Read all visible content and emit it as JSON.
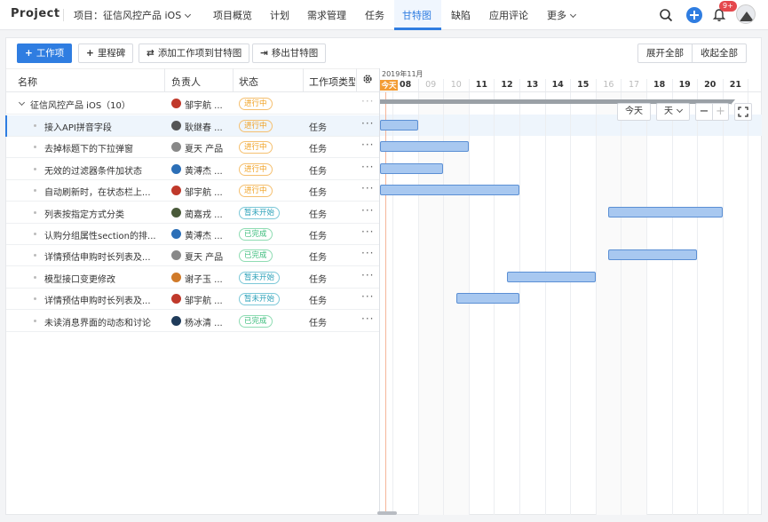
{
  "brand": "Project",
  "project_selector": "项目：征信风控产品 iOS",
  "nav": [
    "项目概览",
    "计划",
    "需求管理",
    "任务",
    "甘特图",
    "缺陷",
    "应用评论",
    "更多"
  ],
  "nav_active": "甘特图",
  "notification_badge": "9+",
  "toolbar": {
    "add_item": "工作项",
    "milestone": "里程碑",
    "add_to_gantt": "添加工作项到甘特图",
    "remove_from_gantt": "移出甘特图",
    "expand_all": "展开全部",
    "collapse_all": "收起全部"
  },
  "columns": [
    "名称",
    "负责人",
    "状态",
    "工作项类型"
  ],
  "group": {
    "name": "征信风控产品 iOS（10）",
    "owner": "邹宇航 ...",
    "status": "进行中"
  },
  "rows": [
    {
      "name": "接入API拼音字段",
      "owner": "耿继春 ...",
      "status": "进行中",
      "type": "任务"
    },
    {
      "name": "去掉标题下的下拉弹窗",
      "owner": "夏天 产品",
      "status": "进行中",
      "type": "任务"
    },
    {
      "name": "无效的过滤器条件加状态",
      "owner": "黄溥杰 ...",
      "status": "进行中",
      "type": "任务"
    },
    {
      "name": "自动刷新时，在状态栏上...",
      "owner": "邹宇航 ...",
      "status": "进行中",
      "type": "任务"
    },
    {
      "name": "列表按指定方式分类",
      "owner": "蔺嘉戎 ...",
      "status": "暂未开始",
      "type": "任务"
    },
    {
      "name": "认购分组属性section的排...",
      "owner": "黄溥杰 ...",
      "status": "已完成",
      "type": "任务"
    },
    {
      "name": "详情预估申购时长列表及...",
      "owner": "夏天 产品",
      "status": "已完成",
      "type": "任务"
    },
    {
      "name": "模型接口变更修改",
      "owner": "谢子玉 ...",
      "status": "暂未开始",
      "type": "任务"
    },
    {
      "name": "详情预估申购时长列表及...",
      "owner": "邹宇航 ...",
      "status": "暂未开始",
      "type": "任务"
    },
    {
      "name": "未读消息界面的动态和讨论",
      "owner": "杨冰清 ...",
      "status": "已完成",
      "type": "任务"
    }
  ],
  "gantt": {
    "month": "2019年11月",
    "days": [
      "今天",
      "08",
      "09",
      "10",
      "11",
      "12",
      "13",
      "14",
      "15",
      "16",
      "17",
      "18",
      "19",
      "20",
      "21"
    ],
    "weekend_days": [
      "09",
      "10",
      "16",
      "17"
    ],
    "today_label": "今天",
    "scale": "天",
    "bars": [
      {
        "start": "07",
        "end": "08"
      },
      {
        "start": "07",
        "end": "10"
      },
      {
        "start": "07",
        "end": "09"
      },
      {
        "start": "07",
        "end": "12"
      },
      {
        "start": "16",
        "end": "20"
      },
      null,
      {
        "start": "16",
        "end": "19"
      },
      {
        "start": "12",
        "end": "15"
      },
      {
        "start": "10",
        "end": "12"
      },
      null
    ]
  }
}
